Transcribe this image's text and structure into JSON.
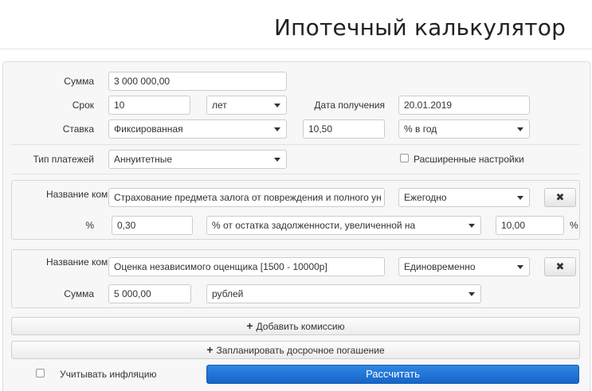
{
  "page": {
    "title": "Ипотечный калькулятор"
  },
  "form": {
    "amount": {
      "label": "Сумма",
      "value": "3 000 000,00"
    },
    "term": {
      "label": "Срок",
      "value": "10",
      "unit": "лет"
    },
    "received_date": {
      "label": "Дата получения",
      "value": "20.01.2019"
    },
    "rate": {
      "label": "Ставка",
      "type": "Фиксированная",
      "value": "10,50",
      "unit": "% в год"
    },
    "payment_type": {
      "label": "Тип платежей",
      "value": "Аннуитетные"
    },
    "advanced": {
      "label": "Расширенные настройки"
    }
  },
  "commissions": [
    {
      "name_label": "Название комиссии",
      "name_value": "Страхование предмета залога от повреждения и полного ун",
      "period": "Ежегодно",
      "sub_label": "%",
      "sub_value": "0,30",
      "sub_type": "% от остатка задолженности, увеличенной на",
      "extra_value": "10,00",
      "extra_unit": "%",
      "remove_icon": "✖"
    },
    {
      "name_label": "Название комиссии",
      "name_value": "Оценка независимого оценщика [1500 - 10000р]",
      "period": "Единовременно",
      "sub_label": "Сумма",
      "sub_value": "5 000,00",
      "sub_type": "рублей",
      "remove_icon": "✖"
    }
  ],
  "actions": {
    "add_commission": "Добавить комиссию",
    "schedule_prepayment": "Запланировать досрочное погашение",
    "plus_icon": "+",
    "inflation": "Учитывать инфляцию",
    "calculate": "Рассчитать"
  }
}
